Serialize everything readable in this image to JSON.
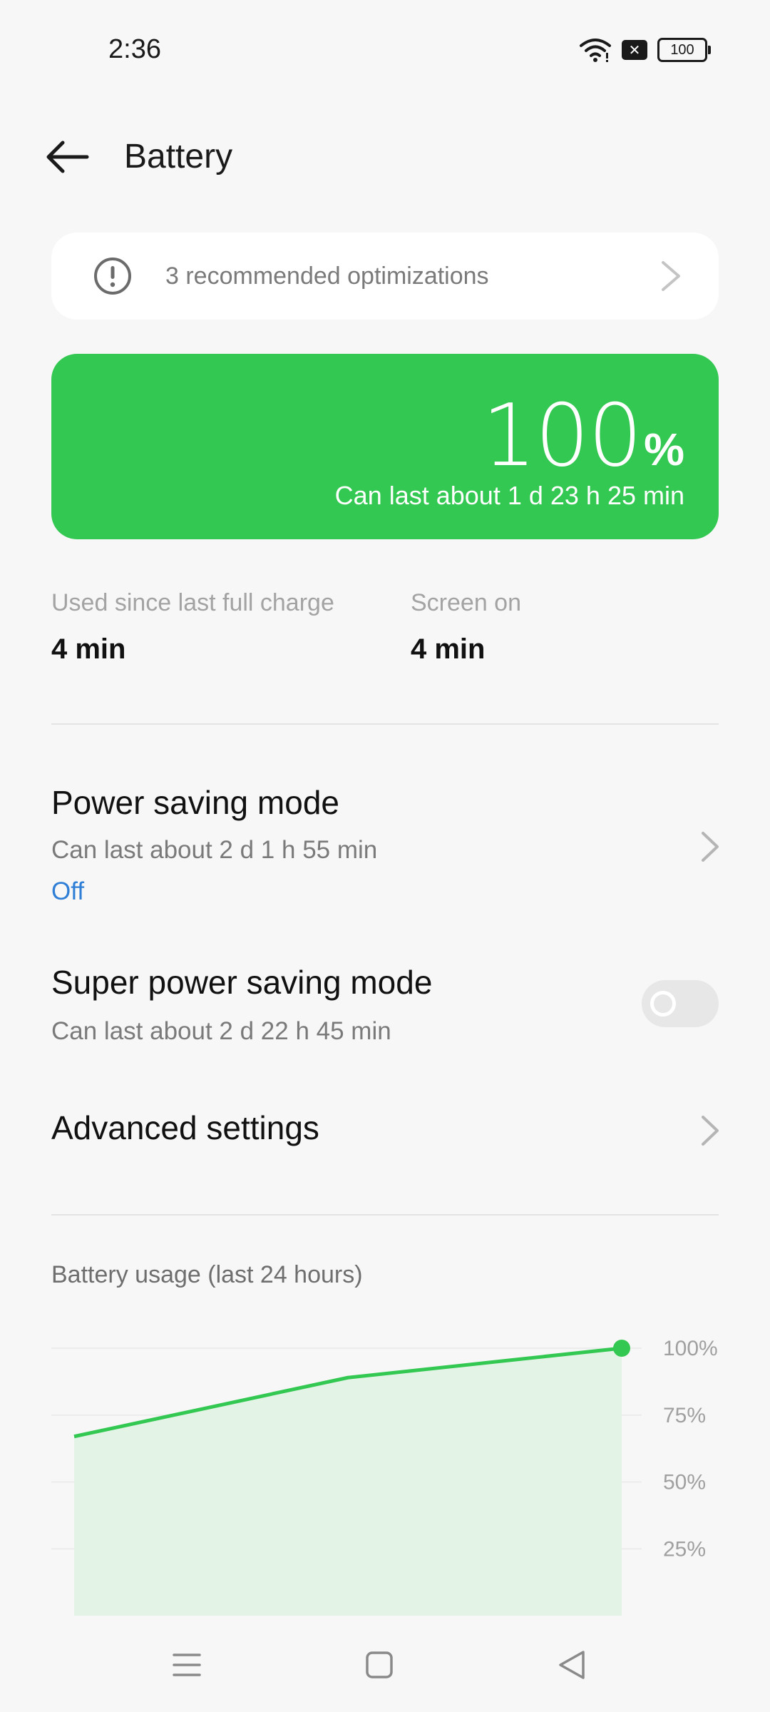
{
  "status_bar": {
    "time": "2:36",
    "battery_level": "100",
    "icons": [
      "wifi-icon",
      "no-sim-icon",
      "battery-icon"
    ]
  },
  "header": {
    "title": "Battery",
    "back_icon": "back-arrow-icon"
  },
  "recommendation": {
    "text": "3 recommended optimizations",
    "icon": "alert-icon"
  },
  "battery_card": {
    "percent": "100",
    "percent_sign": "%",
    "estimate": "Can last about 1 d 23 h 25 min",
    "color": "#33c851"
  },
  "usage": {
    "since_charge_label": "Used since last full charge",
    "since_charge_value": "4 min",
    "screen_on_label": "Screen on",
    "screen_on_value": "4 min"
  },
  "settings": {
    "power_saving": {
      "title": "Power saving mode",
      "subtitle": "Can last about 2 d 1 h 55 min",
      "status": "Off"
    },
    "super_power_saving": {
      "title": "Super power saving mode",
      "subtitle": "Can last about 2 d 22 h 45 min",
      "enabled": false
    },
    "advanced": {
      "title": "Advanced settings"
    }
  },
  "chart_section": {
    "label": "Battery usage (last 24 hours)"
  },
  "chart_data": {
    "type": "area",
    "title": "Battery usage (last 24 hours)",
    "y_tick_labels": [
      "100%",
      "75%",
      "50%",
      "25%"
    ],
    "ylim": [
      0,
      100
    ],
    "x": [
      0,
      0.5,
      1
    ],
    "values": [
      67,
      89,
      100
    ],
    "line_color": "#33c851",
    "fill_color": "#e3f3e6"
  },
  "nav_bar": {
    "icons": [
      "menu-icon",
      "home-icon",
      "back-icon"
    ]
  }
}
